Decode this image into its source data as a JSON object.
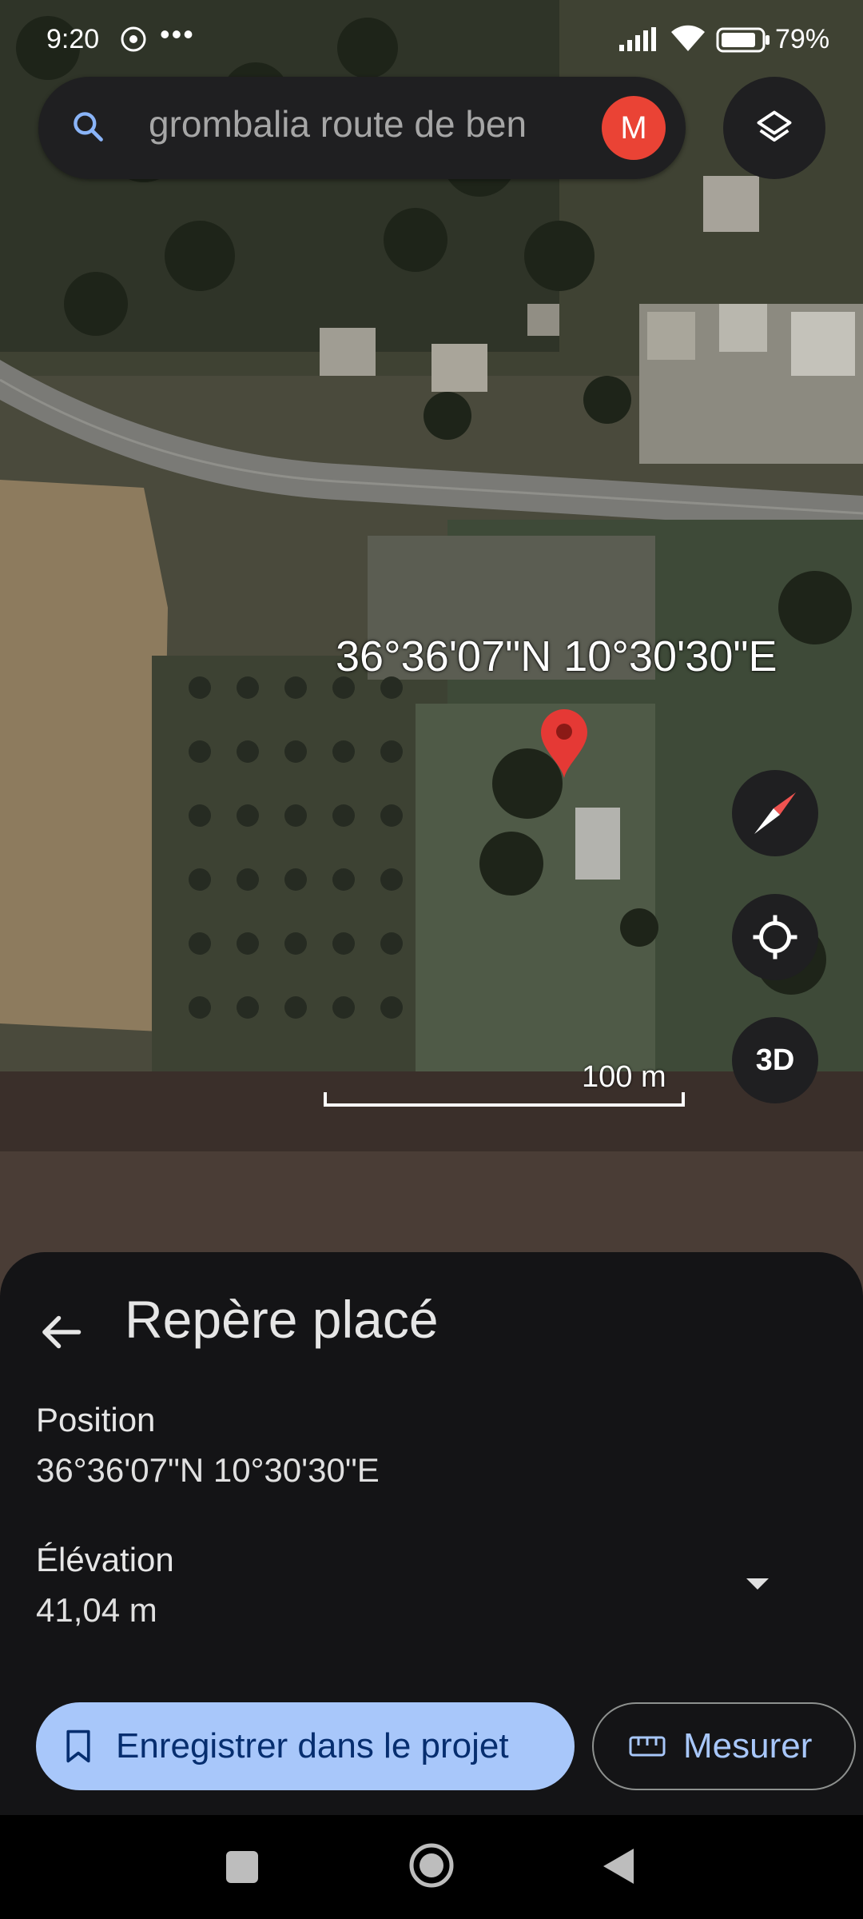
{
  "status_bar": {
    "time": "9:20",
    "dots": "•••",
    "battery": "79%"
  },
  "search": {
    "query": "grombalia route de ben",
    "avatar_letter": "M",
    "avatar_color": "#ea4335"
  },
  "map": {
    "pin_coordinates": "36°36'07\"N 10°30'30\"E",
    "scale": "100 m",
    "three_d_label": "3D",
    "pin_color": "#e53935"
  },
  "panel": {
    "title": "Repère placé",
    "position_label": "Position",
    "position_value": "36°36'07\"N 10°30'30\"E",
    "elevation_label": "Élévation",
    "elevation_value": "41,04 m",
    "save_label": "Enregistrer dans le projet",
    "measure_label": "Mesurer",
    "accent": "#a8c7fa"
  },
  "icons": {
    "search": "search-icon",
    "layers": "layers-icon",
    "compass": "compass-icon",
    "location": "my-location-icon",
    "back": "arrow-back-icon",
    "dropdown": "dropdown-arrow-icon",
    "bookmark": "bookmark-icon",
    "ruler": "ruler-icon"
  }
}
